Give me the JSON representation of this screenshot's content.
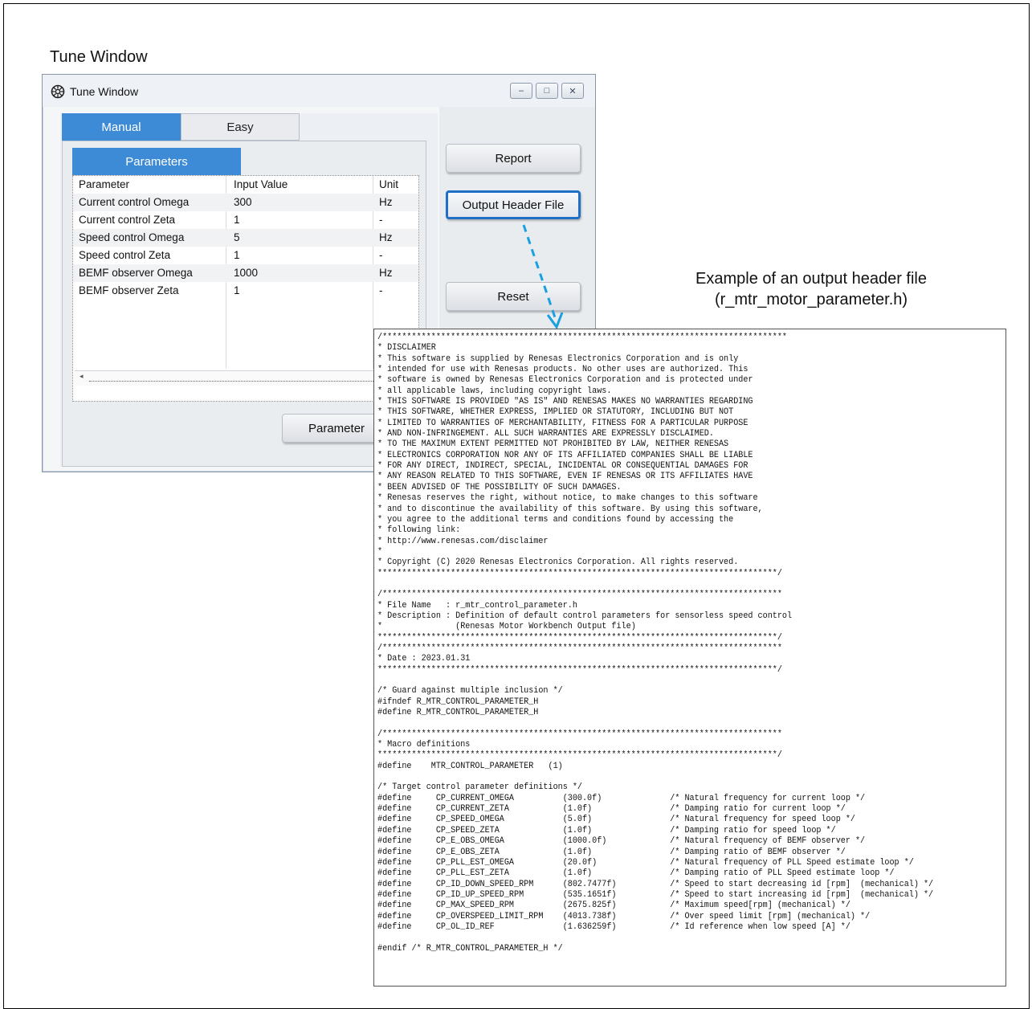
{
  "caption": "Tune Window",
  "window": {
    "title": "Tune Window",
    "icon": "gear-icon",
    "controls": {
      "minimize": "–",
      "maximize": "□",
      "close": "✕"
    }
  },
  "tabs": {
    "manual": "Manual",
    "easy": "Easy"
  },
  "subtab": "Parameters",
  "table": {
    "headers": [
      "Parameter",
      "Input Value",
      "Unit"
    ],
    "rows": [
      [
        "Current control Omega",
        "300",
        "Hz"
      ],
      [
        "Current control Zeta",
        "1",
        "-"
      ],
      [
        "Speed control Omega",
        "5",
        "Hz"
      ],
      [
        "Speed control Zeta",
        "1",
        "-"
      ],
      [
        "BEMF observer Omega",
        "1000",
        "Hz"
      ],
      [
        "BEMF observer Zeta",
        "1",
        "-"
      ]
    ]
  },
  "buttons": {
    "report": "Report",
    "output_header": "Output Header File",
    "reset": "Reset",
    "parameter": "Parameter"
  },
  "colors": {
    "accent": "#3d8ad6",
    "highlight_border": "#1f6fc6",
    "arrow": "#1a9fe0"
  },
  "annotation": {
    "line1": "Example of an output header file",
    "line2": "(r_mtr_motor_parameter.h)"
  },
  "code_lines": [
    "/***********************************************************************************",
    "* DISCLAIMER",
    "* This software is supplied by Renesas Electronics Corporation and is only",
    "* intended for use with Renesas products. No other uses are authorized. This",
    "* software is owned by Renesas Electronics Corporation and is protected under",
    "* all applicable laws, including copyright laws.",
    "* THIS SOFTWARE IS PROVIDED \"AS IS\" AND RENESAS MAKES NO WARRANTIES REGARDING",
    "* THIS SOFTWARE, WHETHER EXPRESS, IMPLIED OR STATUTORY, INCLUDING BUT NOT",
    "* LIMITED TO WARRANTIES OF MERCHANTABILITY, FITNESS FOR A PARTICULAR PURPOSE",
    "* AND NON-INFRINGEMENT. ALL SUCH WARRANTIES ARE EXPRESSLY DISCLAIMED.",
    "* TO THE MAXIMUM EXTENT PERMITTED NOT PROHIBITED BY LAW, NEITHER RENESAS",
    "* ELECTRONICS CORPORATION NOR ANY OF ITS AFFILIATED COMPANIES SHALL BE LIABLE",
    "* FOR ANY DIRECT, INDIRECT, SPECIAL, INCIDENTAL OR CONSEQUENTIAL DAMAGES FOR",
    "* ANY REASON RELATED TO THIS SOFTWARE, EVEN IF RENESAS OR ITS AFFILIATES HAVE",
    "* BEEN ADVISED OF THE POSSIBILITY OF SUCH DAMAGES.",
    "* Renesas reserves the right, without notice, to make changes to this software",
    "* and to discontinue the availability of this software. By using this software,",
    "* you agree to the additional terms and conditions found by accessing the",
    "* following link:",
    "* http://www.renesas.com/disclaimer",
    "*",
    "* Copyright (C) 2020 Renesas Electronics Corporation. All rights reserved.",
    "**********************************************************************************/",
    "",
    "/**********************************************************************************",
    "* File Name   : r_mtr_control_parameter.h",
    "* Description : Definition of default control parameters for sensorless speed control",
    "*               (Renesas Motor Workbench Output file)",
    "**********************************************************************************/",
    "/**********************************************************************************",
    "* Date : 2023.01.31",
    "**********************************************************************************/",
    "",
    "/* Guard against multiple inclusion */",
    "#ifndef R_MTR_CONTROL_PARAMETER_H",
    "#define R_MTR_CONTROL_PARAMETER_H",
    "",
    "/**********************************************************************************",
    "* Macro definitions",
    "**********************************************************************************/",
    "#define    MTR_CONTROL_PARAMETER   (1)",
    "",
    "/* Target control parameter definitions */",
    "#define     CP_CURRENT_OMEGA          (300.0f)              /* Natural frequency for current loop */",
    "#define     CP_CURRENT_ZETA           (1.0f)                /* Damping ratio for current loop */",
    "#define     CP_SPEED_OMEGA            (5.0f)                /* Natural frequency for speed loop */",
    "#define     CP_SPEED_ZETA             (1.0f)                /* Damping ratio for speed loop */",
    "#define     CP_E_OBS_OMEGA            (1000.0f)             /* Natural frequency of BEMF observer */",
    "#define     CP_E_OBS_ZETA             (1.0f)                /* Damping ratio of BEMF observer */",
    "#define     CP_PLL_EST_OMEGA          (20.0f)               /* Natural frequency of PLL Speed estimate loop */",
    "#define     CP_PLL_EST_ZETA           (1.0f)                /* Damping ratio of PLL Speed estimate loop */",
    "#define     CP_ID_DOWN_SPEED_RPM      (802.7477f)           /* Speed to start decreasing id [rpm]  (mechanical) */",
    "#define     CP_ID_UP_SPEED_RPM        (535.1651f)           /* Speed to start increasing id [rpm]  (mechanical) */",
    "#define     CP_MAX_SPEED_RPM          (2675.825f)           /* Maximum speed[rpm] (mechanical) */",
    "#define     CP_OVERSPEED_LIMIT_RPM    (4013.738f)           /* Over speed limit [rpm] (mechanical) */",
    "#define     CP_OL_ID_REF              (1.636259f)           /* Id reference when low speed [A] */",
    "",
    "#endif /* R_MTR_CONTROL_PARAMETER_H */"
  ]
}
